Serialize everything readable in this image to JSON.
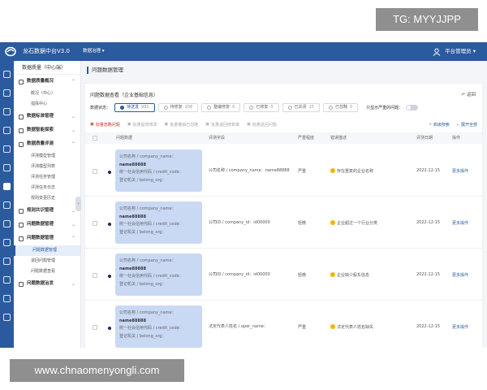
{
  "watermark_top": "TG: MYYJJPP",
  "watermark_bottom": "www.chnaomenyongli.com",
  "topbar": {
    "app_name": "龙石数据中台V3.0",
    "menu": "数据治理 ▾",
    "user": "平台管理员 ▾"
  },
  "sidebar": {
    "title": "数据质量（中心端）",
    "groups": [
      {
        "label": "数据质量概况",
        "items": [
          "概况（中心）",
          "指挥中心"
        ]
      },
      {
        "label": "数据标准管理",
        "items": []
      },
      {
        "label": "数据智能探索",
        "items": []
      },
      {
        "label": "数据质量评测",
        "items": [
          "评测模型管理",
          "评测模型列表",
          "评测任务管理",
          "评测任务日志",
          "规则变更历史"
        ]
      },
      {
        "label": "规则共识管理",
        "items": []
      },
      {
        "label": "问题数据管理",
        "items": []
      },
      {
        "label": "问题数据管理",
        "items": [
          "问题数据管理",
          "退回问题管理",
          "问题数据查看"
        ]
      },
      {
        "label": "问题数据治发",
        "items": []
      }
    ],
    "active_item": "问题数据管理"
  },
  "breadcrumb": "问题数据管理",
  "card": {
    "title": "问题数据查看（企业基础信息）",
    "back": "返回",
    "status_label": "数据状态：",
    "statuses": [
      {
        "label": "待送发",
        "count": "991",
        "selected": true
      },
      {
        "label": "待修复",
        "count": "208",
        "selected": false
      },
      {
        "label": "整编修复",
        "count": "0",
        "selected": false
      },
      {
        "label": "已修复",
        "count": "0",
        "selected": false
      },
      {
        "label": "已关闭",
        "count": "15",
        "selected": false
      },
      {
        "label": "已忽略",
        "count": "0",
        "selected": false
      }
    ],
    "severe_only": "只显示严重的问题：",
    "toolbar": [
      "批量忽略问题",
      "批量提修修改",
      "批量撤销已忽略",
      "批量退回修复审",
      "批量退回问题"
    ],
    "search": "高级搜索",
    "expand": "展开全部"
  },
  "table": {
    "headers": [
      "问题数据",
      "评测字段",
      "严重程度",
      "错误描述",
      "评测日期",
      "操作"
    ],
    "rows": [
      {
        "q1": "公司名称 / company_name：",
        "q1v": "name88888",
        "q2": "统一社会信用代码 / credit_code：",
        "q3": "登记机关 / belong_org：",
        "field": "公司名称 / company_name：name88888",
        "severity": "严重",
        "desc": "存在重复的企业名称",
        "date": "2022-12-15",
        "op": "更多操作"
      },
      {
        "q1": "公司名称 / company_name：",
        "q1v": "name88888",
        "q2": "统一社会信用代码 / credit_code：",
        "q3": "登记机关 / belong_org：",
        "field": "公司ID / company_id：id00000",
        "severity": "轻微",
        "desc": "企业超过一个行业分类",
        "date": "2022-12-15",
        "op": "更多操作"
      },
      {
        "q1": "公司名称 / company_name：",
        "q1v": "name88888",
        "q2": "统一社会信用代码 / credit_code：",
        "q3": "登记机关 / belong_org：",
        "field": "公司ID / company_id：id00000",
        "severity": "轻微",
        "desc": "企业缺少股东信息",
        "date": "2022-12-15",
        "op": "更多操作"
      },
      {
        "q1": "公司名称 / company_name：",
        "q1v": "name88888",
        "q2": "统一社会信用代码 / credit_code：",
        "q3": "登记机关 / belong_org：",
        "field": "法定代表人姓名 / oper_name：",
        "severity": "严重",
        "desc": "法定代表人姓名缺失",
        "date": "2022-12-15",
        "op": "更多操作"
      }
    ]
  }
}
